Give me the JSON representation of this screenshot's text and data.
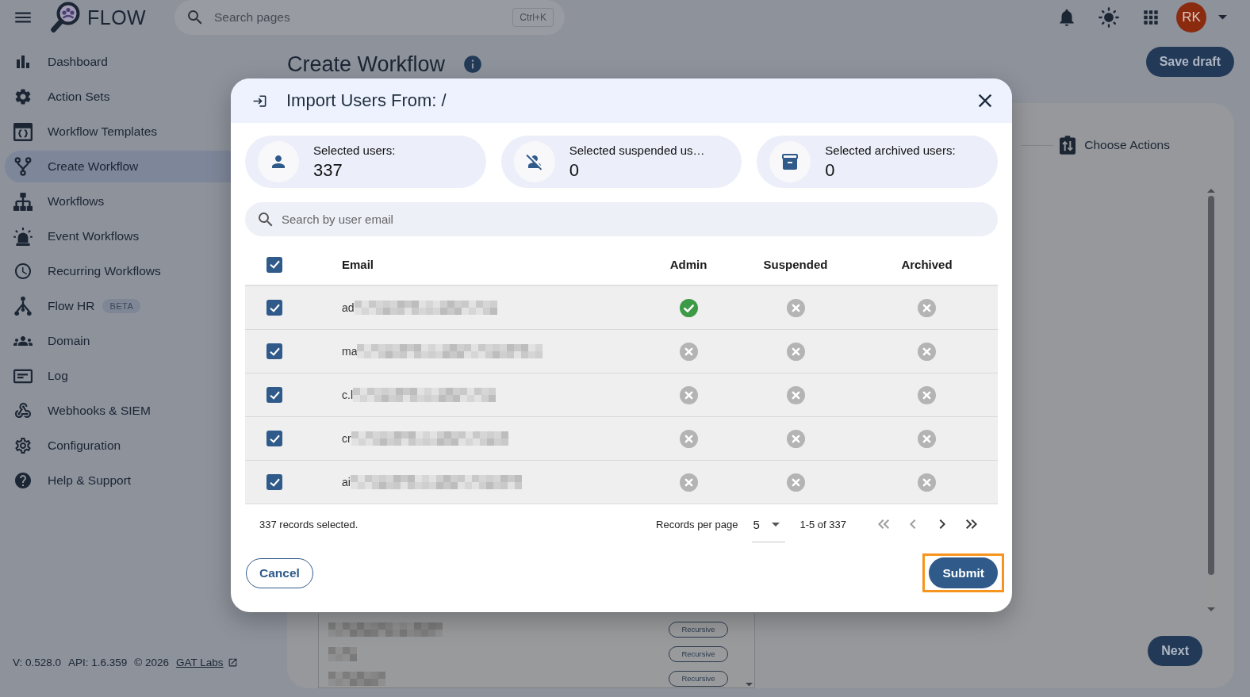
{
  "top_bar": {
    "logo_text": "FLOW",
    "search": {
      "placeholder": "Search pages",
      "shortcut": "Ctrl+K"
    },
    "avatar": {
      "initials": "RK"
    }
  },
  "sidebar": {
    "items": [
      {
        "label": "Dashboard",
        "selected": false
      },
      {
        "label": "Action Sets",
        "selected": false
      },
      {
        "label": "Workflow Templates",
        "selected": false
      },
      {
        "label": "Create Workflow",
        "selected": true
      },
      {
        "label": "Workflows",
        "selected": false
      },
      {
        "label": "Event Workflows",
        "selected": false
      },
      {
        "label": "Recurring Workflows",
        "selected": false
      },
      {
        "label": "Flow HR",
        "selected": false,
        "badge": "BETA"
      },
      {
        "label": "Domain",
        "selected": false
      },
      {
        "label": "Log",
        "selected": false
      },
      {
        "label": "Webhooks & SIEM",
        "selected": false
      },
      {
        "label": "Configuration",
        "selected": false
      },
      {
        "label": "Help & Support",
        "selected": false
      }
    ],
    "footer": {
      "version": "V: 0.528.0",
      "api": "API: 1.6.359",
      "copyright": "© 2026",
      "link": "GAT Labs"
    }
  },
  "page": {
    "title": "Create Workflow",
    "save_button": "Save draft",
    "step": "Choose Actions",
    "list_rows": [
      {
        "tag": "Recursive"
      },
      {
        "tag": "Recursive"
      },
      {
        "tag": "Recursive"
      }
    ],
    "next_button": "Next"
  },
  "dialog": {
    "title": "Import Users From: /",
    "stats": [
      {
        "label": "Selected users:",
        "value": "337"
      },
      {
        "label": "Selected suspended us…",
        "value": "0"
      },
      {
        "label": "Selected archived users:",
        "value": "0"
      }
    ],
    "search": {
      "placeholder": "Search by user email"
    },
    "table": {
      "select_all": true,
      "columns": [
        "Email",
        "Admin",
        "Suspended",
        "Archived"
      ],
      "rows": [
        {
          "checked": true,
          "email": "ad",
          "admin": true,
          "suspended": false,
          "archived": false
        },
        {
          "checked": true,
          "email": "ma",
          "admin": false,
          "suspended": false,
          "archived": false
        },
        {
          "checked": true,
          "email": "c.l",
          "admin": false,
          "suspended": false,
          "archived": false
        },
        {
          "checked": true,
          "email": "cr",
          "admin": false,
          "suspended": false,
          "archived": false
        },
        {
          "checked": true,
          "email": "ai",
          "admin": false,
          "suspended": false,
          "archived": false
        }
      ]
    },
    "footer": {
      "summary": "337 records selected.",
      "per_page_label": "Records per page",
      "per_page": "5",
      "range": "1-5 of 337",
      "pager": [
        {
          "kind": "first",
          "disabled": true
        },
        {
          "kind": "previous",
          "disabled": true
        },
        {
          "kind": "next",
          "disabled": false
        },
        {
          "kind": "last",
          "disabled": false
        }
      ]
    },
    "cancel_button": "Cancel",
    "submit": {
      "label": "Submit",
      "highlighted": true
    }
  }
}
